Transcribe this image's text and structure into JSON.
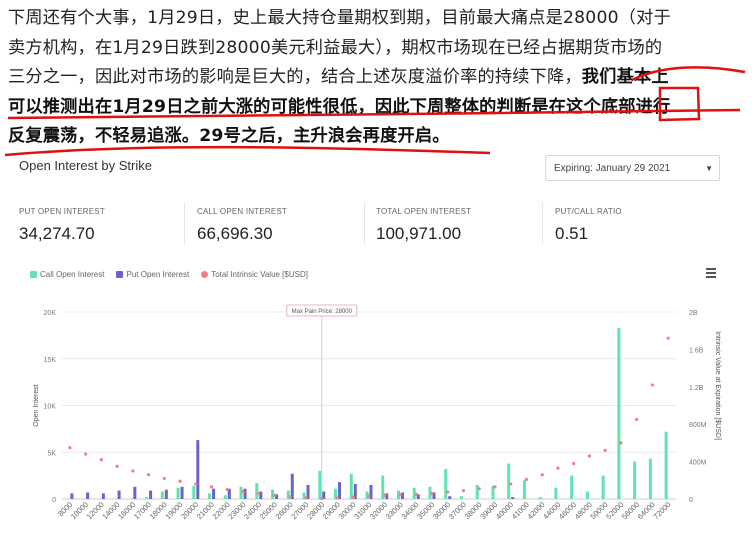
{
  "article": {
    "line1": "下周还有个大事，1月29日，史上最大持仓量期权到期，目前最大痛点是28000（对于",
    "line2": "卖方机构，在1月29日跌到28000美元利益最大），期权市场现在已经占据期货市场的",
    "line3a": "三分之一，因此对市场的影响是巨大的，结合上述灰度溢价率的持续下降，",
    "line3b": "我们基本上",
    "line4": "可以推测出在1月29日之前大涨的可能性很低，因此下周整体的判断是在这个底部进行",
    "line5": "反复震荡，不轻易追涨。29号之后，主升浪会再度开启。"
  },
  "chart_title": "Open Interest by Strike",
  "expiry_select": {
    "value": "Expiring: January 29 2021"
  },
  "stats": [
    {
      "label": "PUT OPEN INTEREST",
      "value": "34,274.70"
    },
    {
      "label": "CALL OPEN INTEREST",
      "value": "66,696.30"
    },
    {
      "label": "TOTAL OPEN INTEREST",
      "value": "100,971.00"
    },
    {
      "label": "PUT/CALL RATIO",
      "value": "0.51"
    }
  ],
  "colors": {
    "call": "#5fe3b0",
    "put": "#6b63c8",
    "intrinsic": "#f08080"
  },
  "chart_data": {
    "type": "bar",
    "legend": [
      "Call Open Interest",
      "Put Open Interest",
      "Total Intrinsic Value [$USD]"
    ],
    "ylabel": "Open Interest",
    "y2label": "Intrinsic Value at Expiration [$USD]",
    "ylim": [
      0,
      20000
    ],
    "y_ticks": [
      "0",
      "5K",
      "10K",
      "15K",
      "20K"
    ],
    "y2_ticks": [
      "0",
      "400M",
      "800M",
      "1.2B",
      "1.6B",
      "2B"
    ],
    "y2lim": [
      0,
      2000000000
    ],
    "annotation": "Max Pain Price: 28000",
    "max_pain_strike": "28000",
    "categories": [
      "8000",
      "10000",
      "12000",
      "14000",
      "16000",
      "17000",
      "18000",
      "19000",
      "20000",
      "21000",
      "22000",
      "23000",
      "24000",
      "25000",
      "26000",
      "27000",
      "28000",
      "29000",
      "30000",
      "31000",
      "32000",
      "33000",
      "34000",
      "35000",
      "36000",
      "37000",
      "38000",
      "39000",
      "40000",
      "41000",
      "42000",
      "44000",
      "46000",
      "48000",
      "50000",
      "52000",
      "56000",
      "64000",
      "72000"
    ],
    "x_tick_labels": [
      "8000",
      "10000",
      "12000",
      "14000",
      "16000",
      "17000",
      "18000",
      "19000",
      "20000",
      "21000",
      "22000",
      "23000",
      "24000",
      "25000",
      "26000",
      "27000",
      "28000",
      "29000",
      "30000",
      "31000",
      "32000",
      "33000",
      "34000",
      "35000",
      "36000",
      "37000",
      "38000",
      "39000",
      "40000",
      "41000",
      "42000",
      "44000",
      "46000",
      "48000",
      "50000",
      "52000",
      "56000",
      "64000",
      "72000"
    ],
    "series": [
      {
        "name": "Call Open Interest",
        "values": [
          0,
          0,
          0,
          0,
          0,
          200,
          800,
          1200,
          1400,
          600,
          400,
          1300,
          1700,
          1000,
          900,
          700,
          3000,
          1100,
          2700,
          800,
          2500,
          900,
          1200,
          1300,
          3200,
          300,
          1500,
          1400,
          3800,
          2000,
          200,
          1200,
          2500,
          800,
          2500,
          18300,
          4000,
          4300,
          7200
        ]
      },
      {
        "name": "Put Open Interest",
        "values": [
          600,
          700,
          600,
          900,
          1300,
          900,
          1000,
          1300,
          6300,
          1100,
          1100,
          1100,
          800,
          500,
          2700,
          1500,
          800,
          1800,
          1600,
          1500,
          600,
          700,
          500,
          700,
          300,
          0,
          0,
          0,
          200,
          0,
          0,
          0,
          0,
          0,
          0,
          0,
          0,
          0,
          0
        ]
      },
      {
        "name": "Total Intrinsic Value [$USD]",
        "values": [
          550000000,
          480000000,
          420000000,
          350000000,
          300000000,
          260000000,
          220000000,
          190000000,
          160000000,
          130000000,
          100000000,
          80000000,
          60000000,
          40000000,
          25000000,
          12000000,
          5000000,
          10000000,
          20000000,
          30000000,
          40000000,
          45000000,
          50000000,
          60000000,
          75000000,
          90000000,
          110000000,
          130000000,
          160000000,
          210000000,
          260000000,
          330000000,
          380000000,
          460000000,
          520000000,
          600000000,
          850000000,
          1220000000,
          1720000000
        ]
      }
    ]
  }
}
